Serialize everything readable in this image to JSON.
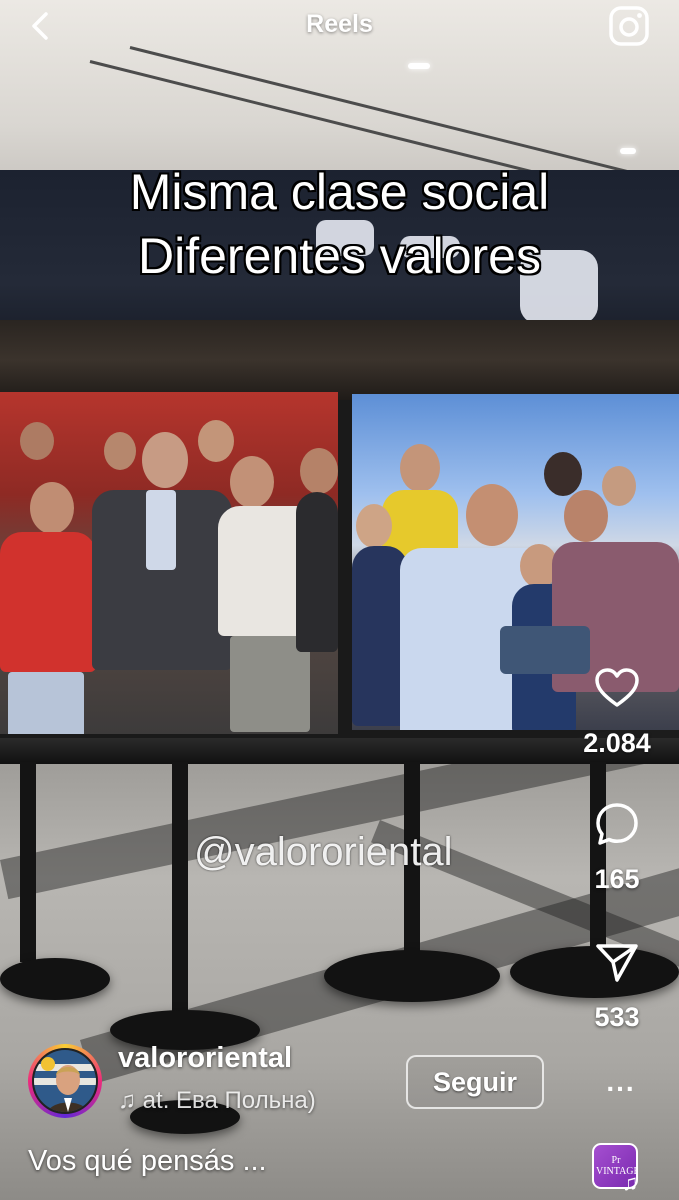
{
  "header": {
    "title": "Reels",
    "back_icon": "chevron-left-icon",
    "camera_icon": "camera-icon"
  },
  "video": {
    "overlay_line_1": "Misma clase social",
    "overlay_line_2": "Diferentes valores",
    "watermark": "@valororiental"
  },
  "actions": {
    "like_count": "2.084",
    "comment_count": "165",
    "share_count": "533",
    "like_icon": "heart-icon",
    "comment_icon": "comment-bubble-icon",
    "share_icon": "paper-plane-icon"
  },
  "author": {
    "username": "valororiental",
    "audio_note_icon": "music-note-icon",
    "audio_text": "at. Ева Польна)",
    "follow_label": "Seguir",
    "more_label": "..."
  },
  "post": {
    "caption": "Vos qué pensás ...",
    "audio_thumb_text": "Pr VINTAGE",
    "audio_thumb_icon": "music-note-icon"
  },
  "colors": {
    "story_ring_start": "#f9ce34",
    "story_ring_mid": "#ee2a7b",
    "story_ring_end": "#6228d7",
    "text": "#ffffff"
  }
}
